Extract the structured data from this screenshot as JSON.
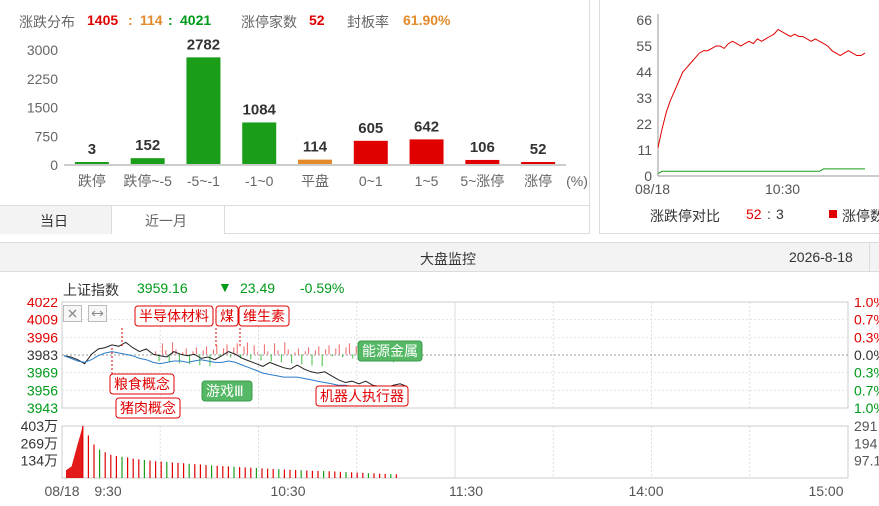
{
  "dist_panel": {
    "title": "涨跌分布",
    "up": "1405",
    "sep": ":",
    "flat": "114",
    "down": "4021",
    "limit_label": "涨停家数",
    "limit_value": "52",
    "seal_label": "封板率",
    "seal_value": "61.90%",
    "tabs": [
      "当日",
      "近一月"
    ],
    "unit": "(%)"
  },
  "ratio_panel": {
    "label": "涨跌停对比",
    "value_up": "52",
    "value_sep": ":",
    "value_down": "3",
    "legend": "涨停数"
  },
  "monitor": {
    "title": "大盘监控",
    "date": "2026-8-18",
    "index_name": "上证指数",
    "index_value": "3959.16",
    "change_arrow": "▼",
    "change_value": "23.49",
    "change_pct": "-0.59%",
    "left_price_ticks": [
      "4022",
      "4009",
      "3996",
      "3983",
      "3969",
      "3956",
      "3943"
    ],
    "right_pct_ticks": [
      "1.0%",
      "0.7%",
      "0.3%",
      "0.0%",
      "0.3%",
      "0.7%",
      "1.0%"
    ],
    "volume_ticks": [
      "403万",
      "269万",
      "134万"
    ],
    "right_volume_ticks": [
      "291",
      "194",
      "97.1"
    ],
    "time_ticks": [
      "08/18",
      "9:30",
      "10:30",
      "11:30",
      "14:00",
      "15:00"
    ],
    "tags": [
      "半导体材料",
      "煤",
      "维生素",
      "粮食概念",
      "猪肉概念",
      "游戏Ⅲ",
      "能源金属",
      "机器人执行器"
    ],
    "tool_icons": [
      "close-icon",
      "expand-icon"
    ]
  },
  "chart_data": [
    {
      "type": "bar",
      "title": "",
      "categories": [
        "跌停",
        "跌停~-5",
        "-5~-1",
        "-1~0",
        "平盘",
        "0~1",
        "1~5",
        "5~涨停",
        "涨停"
      ],
      "values": [
        3,
        152,
        2782,
        1084,
        114,
        605,
        642,
        106,
        52
      ],
      "colors": [
        "#1a9e1a",
        "#1a9e1a",
        "#1a9e1a",
        "#1a9e1a",
        "#e38a2c",
        "#e10000",
        "#e10000",
        "#e10000",
        "#e10000"
      ],
      "ylim": [
        0,
        3000
      ],
      "yticks": [
        "3000",
        "2250",
        "1500",
        "750",
        "0"
      ]
    },
    {
      "type": "line",
      "title": "",
      "x_ticks": [
        "08/18",
        "10:30"
      ],
      "ylim": [
        0,
        66
      ],
      "yticks": [
        "66",
        "55",
        "44",
        "33",
        "22",
        "11",
        "0"
      ],
      "series": [
        {
          "name": "涨停数",
          "color": "#e10000",
          "values": [
            12,
            20,
            27,
            32,
            36,
            40,
            44,
            46,
            48,
            50,
            52,
            53,
            53,
            54,
            55,
            55,
            54,
            56,
            57,
            56,
            55,
            56,
            57,
            56,
            58,
            57,
            58,
            59,
            60,
            62,
            61,
            60,
            59,
            60,
            59,
            59,
            58,
            57,
            58,
            57,
            56,
            55,
            53,
            52,
            51,
            52,
            53,
            52,
            51,
            51,
            52
          ]
        },
        {
          "color": "#1a9e1a",
          "values": [
            1,
            2,
            2,
            2,
            2,
            2,
            2,
            2,
            2,
            2,
            2,
            2,
            2,
            2,
            2,
            2,
            2,
            2,
            2,
            2,
            2,
            2,
            2,
            2,
            2,
            2,
            2,
            2,
            2,
            2,
            2,
            2,
            2,
            2,
            2,
            2,
            2,
            2,
            2,
            2,
            3,
            3,
            3,
            3,
            3,
            3,
            3,
            3,
            3,
            3,
            3
          ]
        }
      ]
    },
    {
      "type": "line",
      "title": "",
      "ylim": [
        3943,
        4022
      ],
      "base": 3983,
      "series": [
        {
          "color": "#222",
          "values": [
            3982,
            3981,
            3979,
            3976,
            3983,
            3987,
            3988,
            3990,
            3989,
            3992,
            3988,
            3985,
            3987,
            3983,
            3982,
            3981,
            3985,
            3983,
            3982,
            3983,
            3980,
            3981,
            3979,
            3982,
            3985,
            3983,
            3980,
            3978,
            3976,
            3974,
            3977,
            3975,
            3973,
            3972,
            3975,
            3972,
            3970,
            3969,
            3970,
            3967,
            3964,
            3962,
            3963,
            3961,
            3963,
            3960,
            3959,
            3958,
            3960,
            3961,
            3959
          ]
        },
        {
          "color": "#2a7cc7",
          "values": [
            3982,
            3980,
            3978,
            3977,
            3979,
            3982,
            3984,
            3985,
            3984,
            3983,
            3982,
            3980,
            3979,
            3977,
            3976,
            3977,
            3978,
            3978,
            3977,
            3978,
            3979,
            3978,
            3977,
            3977,
            3978,
            3977,
            3975,
            3973,
            3971,
            3969,
            3968,
            3967,
            3966,
            3966,
            3966,
            3965,
            3964,
            3963,
            3962,
            3961,
            3960,
            3960,
            3959,
            3959,
            3958,
            3958,
            3957,
            3957,
            3957,
            3957,
            3957
          ]
        }
      ]
    },
    {
      "type": "bar",
      "title": "",
      "ylim": [
        0,
        403
      ],
      "values": [
        60,
        90,
        250,
        403,
        330,
        260,
        220,
        200,
        180,
        170,
        165,
        160,
        150,
        145,
        140,
        135,
        130,
        128,
        125,
        120,
        118,
        115,
        110,
        108,
        105,
        100,
        98,
        95,
        92,
        90,
        88,
        85,
        82,
        80,
        78,
        75,
        72,
        70,
        68,
        66,
        64,
        62,
        60,
        58,
        56,
        55,
        54,
        52,
        50,
        48,
        46,
        44,
        42,
        40,
        38,
        36,
        34,
        32,
        30,
        28
      ]
    }
  ]
}
